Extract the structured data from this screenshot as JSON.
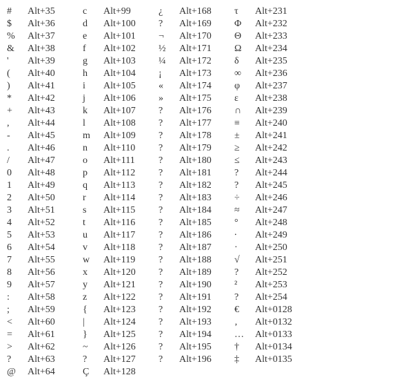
{
  "columns": [
    [
      {
        "ch": "#",
        "code": "Alt+35"
      },
      {
        "ch": "$",
        "code": "Alt+36"
      },
      {
        "ch": "%",
        "code": "Alt+37"
      },
      {
        "ch": "&",
        "code": "Alt+38"
      },
      {
        "ch": "'",
        "code": "Alt+39"
      },
      {
        "ch": "(",
        "code": "Alt+40"
      },
      {
        "ch": ")",
        "code": "Alt+41"
      },
      {
        "ch": "*",
        "code": "Alt+42"
      },
      {
        "ch": "+",
        "code": "Alt+43"
      },
      {
        "ch": ",",
        "code": "Alt+44"
      },
      {
        "ch": "-",
        "code": "Alt+45"
      },
      {
        "ch": ".",
        "code": "Alt+46"
      },
      {
        "ch": "/",
        "code": "Alt+47"
      },
      {
        "ch": "0",
        "code": "Alt+48"
      },
      {
        "ch": "1",
        "code": "Alt+49"
      },
      {
        "ch": "2",
        "code": "Alt+50"
      },
      {
        "ch": "3",
        "code": "Alt+51"
      },
      {
        "ch": "4",
        "code": "Alt+52"
      },
      {
        "ch": "5",
        "code": "Alt+53"
      },
      {
        "ch": "6",
        "code": "Alt+54"
      },
      {
        "ch": "7",
        "code": "Alt+55"
      },
      {
        "ch": "8",
        "code": "Alt+56"
      },
      {
        "ch": "9",
        "code": "Alt+57"
      },
      {
        "ch": ":",
        "code": "Alt+58"
      },
      {
        "ch": ";",
        "code": "Alt+59"
      },
      {
        "ch": "<",
        "code": "Alt+60"
      },
      {
        "ch": "=",
        "code": "Alt+61"
      },
      {
        "ch": ">",
        "code": "Alt+62"
      },
      {
        "ch": "?",
        "code": "Alt+63"
      },
      {
        "ch": "@",
        "code": "Alt+64"
      }
    ],
    [
      {
        "ch": "c",
        "code": "Alt+99"
      },
      {
        "ch": "d",
        "code": "Alt+100"
      },
      {
        "ch": "e",
        "code": "Alt+101"
      },
      {
        "ch": "f",
        "code": "Alt+102"
      },
      {
        "ch": "g",
        "code": "Alt+103"
      },
      {
        "ch": "h",
        "code": "Alt+104"
      },
      {
        "ch": "i",
        "code": "Alt+105"
      },
      {
        "ch": "j",
        "code": "Alt+106"
      },
      {
        "ch": "k",
        "code": "Alt+107"
      },
      {
        "ch": "l",
        "code": "Alt+108"
      },
      {
        "ch": "m",
        "code": "Alt+109"
      },
      {
        "ch": "n",
        "code": "Alt+110"
      },
      {
        "ch": "o",
        "code": "Alt+111"
      },
      {
        "ch": "p",
        "code": "Alt+112"
      },
      {
        "ch": "q",
        "code": "Alt+113"
      },
      {
        "ch": "r",
        "code": "Alt+114"
      },
      {
        "ch": "s",
        "code": "Alt+115"
      },
      {
        "ch": "t",
        "code": "Alt+116"
      },
      {
        "ch": "u",
        "code": "Alt+117"
      },
      {
        "ch": "v",
        "code": "Alt+118"
      },
      {
        "ch": "w",
        "code": "Alt+119"
      },
      {
        "ch": "x",
        "code": "Alt+120"
      },
      {
        "ch": "y",
        "code": "Alt+121"
      },
      {
        "ch": "z",
        "code": "Alt+122"
      },
      {
        "ch": "{",
        "code": "Alt+123"
      },
      {
        "ch": "|",
        "code": "Alt+124"
      },
      {
        "ch": "}",
        "code": "Alt+125"
      },
      {
        "ch": "~",
        "code": "Alt+126"
      },
      {
        "ch": "?",
        "code": "Alt+127"
      },
      {
        "ch": "Ç",
        "code": "Alt+128"
      }
    ],
    [
      {
        "ch": "¿",
        "code": "Alt+168"
      },
      {
        "ch": "?",
        "code": "Alt+169"
      },
      {
        "ch": "¬",
        "code": "Alt+170"
      },
      {
        "ch": "½",
        "code": "Alt+171"
      },
      {
        "ch": "¼",
        "code": "Alt+172"
      },
      {
        "ch": "¡",
        "code": "Alt+173"
      },
      {
        "ch": "«",
        "code": "Alt+174"
      },
      {
        "ch": "»",
        "code": "Alt+175"
      },
      {
        "ch": "?",
        "code": "Alt+176"
      },
      {
        "ch": "?",
        "code": "Alt+177"
      },
      {
        "ch": "?",
        "code": "Alt+178"
      },
      {
        "ch": "?",
        "code": "Alt+179"
      },
      {
        "ch": "?",
        "code": "Alt+180"
      },
      {
        "ch": "?",
        "code": "Alt+181"
      },
      {
        "ch": "?",
        "code": "Alt+182"
      },
      {
        "ch": "?",
        "code": "Alt+183"
      },
      {
        "ch": "?",
        "code": "Alt+184"
      },
      {
        "ch": "?",
        "code": "Alt+185"
      },
      {
        "ch": "?",
        "code": "Alt+186"
      },
      {
        "ch": "?",
        "code": "Alt+187"
      },
      {
        "ch": "?",
        "code": "Alt+188"
      },
      {
        "ch": "?",
        "code": "Alt+189"
      },
      {
        "ch": "?",
        "code": "Alt+190"
      },
      {
        "ch": "?",
        "code": "Alt+191"
      },
      {
        "ch": "?",
        "code": "Alt+192"
      },
      {
        "ch": "?",
        "code": "Alt+193"
      },
      {
        "ch": "?",
        "code": "Alt+194"
      },
      {
        "ch": "?",
        "code": "Alt+195"
      },
      {
        "ch": "?",
        "code": "Alt+196"
      }
    ],
    [
      {
        "ch": "τ",
        "code": "Alt+231"
      },
      {
        "ch": "Φ",
        "code": "Alt+232"
      },
      {
        "ch": "Θ",
        "code": "Alt+233"
      },
      {
        "ch": "Ω",
        "code": "Alt+234"
      },
      {
        "ch": "δ",
        "code": "Alt+235"
      },
      {
        "ch": "∞",
        "code": "Alt+236"
      },
      {
        "ch": "φ",
        "code": "Alt+237"
      },
      {
        "ch": "ε",
        "code": "Alt+238"
      },
      {
        "ch": "∩",
        "code": "Alt+239"
      },
      {
        "ch": "≡",
        "code": "Alt+240"
      },
      {
        "ch": "±",
        "code": "Alt+241"
      },
      {
        "ch": "≥",
        "code": "Alt+242"
      },
      {
        "ch": "≤",
        "code": "Alt+243"
      },
      {
        "ch": "?",
        "code": "Alt+244"
      },
      {
        "ch": "?",
        "code": "Alt+245"
      },
      {
        "ch": "÷",
        "code": "Alt+246"
      },
      {
        "ch": "≈",
        "code": "Alt+247"
      },
      {
        "ch": "°",
        "code": "Alt+248"
      },
      {
        "ch": "∙",
        "code": "Alt+249"
      },
      {
        "ch": "·",
        "code": "Alt+250"
      },
      {
        "ch": "√",
        "code": "Alt+251"
      },
      {
        "ch": "?",
        "code": "Alt+252"
      },
      {
        "ch": "²",
        "code": "Alt+253"
      },
      {
        "ch": "?",
        "code": "Alt+254"
      },
      {
        "ch": "€",
        "code": "Alt+0128"
      },
      {
        "ch": "‚",
        "code": "Alt+0132"
      },
      {
        "ch": "…",
        "code": "Alt+0133"
      },
      {
        "ch": "†",
        "code": "Alt+0134"
      },
      {
        "ch": "‡",
        "code": "Alt+0135"
      }
    ]
  ]
}
